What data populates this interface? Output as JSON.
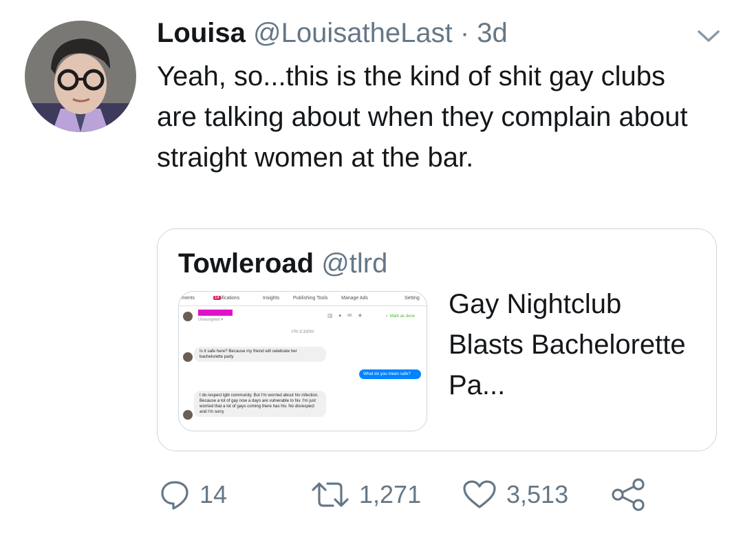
{
  "tweet": {
    "author_name": "Louisa",
    "author_handle": "@LouisatheLast",
    "separator": "·",
    "time": "3d",
    "text": "Yeah, so...this is the kind of shit gay clubs are talking about when they complain about straight women at the bar."
  },
  "quote": {
    "author_name": "Towleroad",
    "author_handle": "@tlrd",
    "link_title": "Gay Nightclub Blasts Bachelorette Pa...",
    "media": {
      "tabs": [
        "ments",
        "Notifications",
        "Insights",
        "Publishing Tools",
        "Manage Ads",
        "Setting"
      ],
      "notifications_badge": "14",
      "unassigned_label": "Unassigned ▾",
      "mark_done_label": "✓  Mark as done",
      "date_label": "FRI 8:30PM",
      "messages": [
        {
          "direction": "in",
          "text": "Is it safe here? Because my friend will celebrate her bachelorette party"
        },
        {
          "direction": "out",
          "text": "What do you mean safe?"
        },
        {
          "direction": "in",
          "text": "I do respect lgbt community. But I'm worried about hiv infection. Because a lot of gay now a days are vulnerable to hiv. I'm just worried that a lot of gays coming there has hiv. No disrespect and I'm sorry"
        }
      ]
    }
  },
  "actions": {
    "reply_count": "14",
    "retweet_count": "1,271",
    "like_count": "3,513"
  },
  "icons": {
    "reply": "reply-icon",
    "retweet": "retweet-icon",
    "like": "like-icon",
    "share": "share-icon",
    "more": "chevron-down-icon"
  },
  "colors": {
    "text": "#14171a",
    "secondary": "#657786",
    "border": "#ccd6dd",
    "redaction": "#e011c8",
    "messenger_blue": "#0084ff"
  }
}
